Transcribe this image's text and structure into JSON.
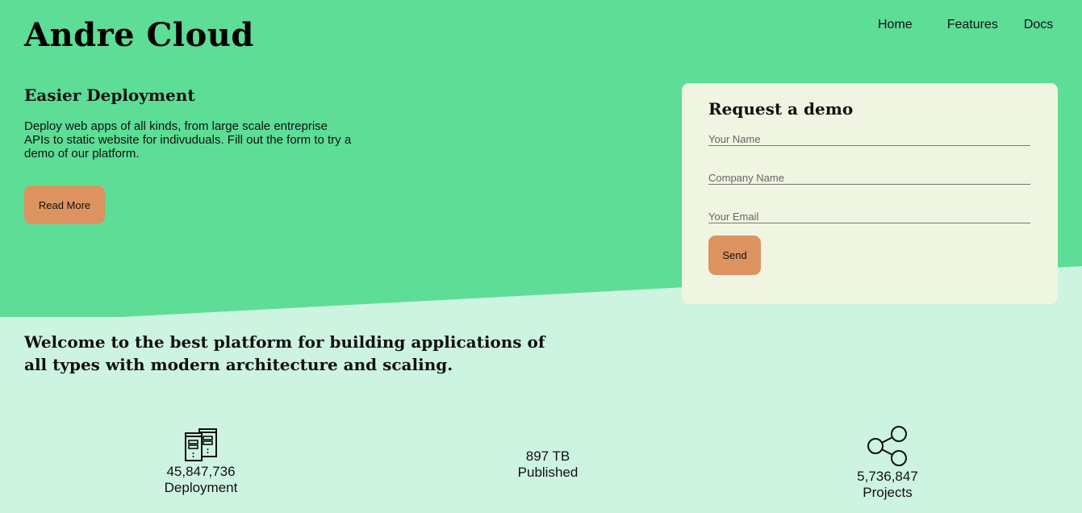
{
  "brand": {
    "name": "Andre Cloud"
  },
  "nav": {
    "items": [
      "Home",
      "Features",
      "Docs"
    ]
  },
  "hero": {
    "heading": "Easier Deployment",
    "text": "Deploy web apps of all kinds, from large scale entreprise APIs to static website for indivuduals. Fill out the form to try a demo of our platform.",
    "button_label": "Read More"
  },
  "demo_form": {
    "title": "Request a demo",
    "name_placeholder": "Your Name",
    "company_placeholder": "Company Name",
    "email_placeholder": "Your Email",
    "submit_label": "Send"
  },
  "welcome": {
    "text": "Welcome to the best platform for building applications of all types with modern architecture and scaling."
  },
  "stats": [
    {
      "icon": "server-icon",
      "value": "45,847,736",
      "label": "Deployment"
    },
    {
      "value": "897 TB",
      "label": "Published"
    },
    {
      "icon": "share-icon",
      "value": "5,736,847",
      "label": "Projects"
    }
  ],
  "colors": {
    "hero_green": "#5ddd96",
    "page_mint": "#cdf4e0",
    "card_cream": "#eff5e0",
    "button_orange": "#dc935f"
  }
}
